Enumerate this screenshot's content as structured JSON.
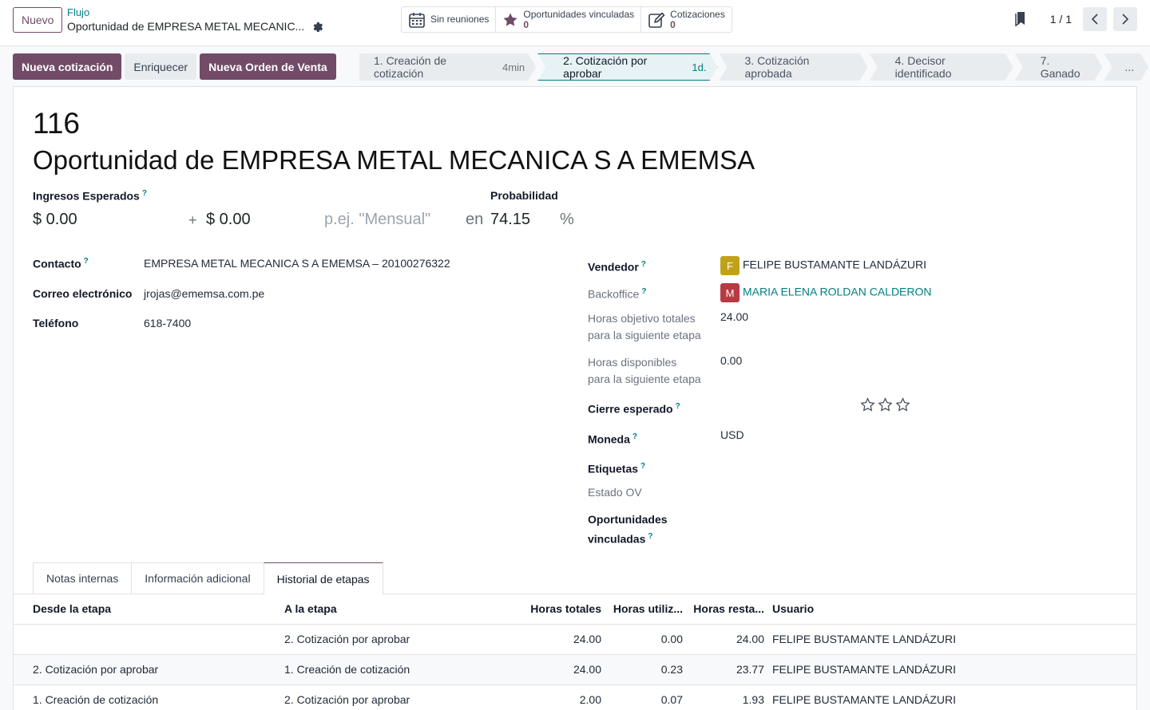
{
  "control_panel": {
    "new_label": "Nuevo",
    "breadcrumb_parent": "Flujo",
    "breadcrumb_current": "Oportunidad de EMPRESA METAL MECANIC...",
    "smart_buttons": [
      {
        "icon": "calendar-icon",
        "label": "Sin reuniones",
        "count": ""
      },
      {
        "icon": "star-icon",
        "label": "Oportunidades vinculadas",
        "count": "0"
      },
      {
        "icon": "edit-icon",
        "label": "Cotizaciones",
        "count": "0"
      }
    ],
    "pager": "1 / 1"
  },
  "actions": {
    "new_quotation": "Nueva cotización",
    "enrich": "Enriquecer",
    "new_sale_order": "Nueva Orden de Venta"
  },
  "stages": [
    {
      "label": "1. Creación de cotización",
      "duration": "4min",
      "active": false
    },
    {
      "label": "2. Cotización por aprobar",
      "duration": "1d.",
      "active": true
    },
    {
      "label": "3. Cotización aprobada",
      "duration": "",
      "active": false
    },
    {
      "label": "4. Decisor identificado",
      "duration": "",
      "active": false
    },
    {
      "label": "7. Ganado",
      "duration": "",
      "active": false
    },
    {
      "label": "...",
      "duration": "",
      "active": false
    }
  ],
  "record": {
    "id": "116",
    "name": "Oportunidad de EMPRESA METAL MECANICA S A EMEMSA",
    "expected_revenue_label": "Ingresos Esperados",
    "expected_revenue": "$ 0.00",
    "plus": "+",
    "recurring_revenue": "$ 0.00",
    "recurring_placeholder": "p.ej. \"Mensual\"",
    "en": "en",
    "probability_label": "Probabilidad",
    "probability": "74.15",
    "percent": "%"
  },
  "left_fields": {
    "contact_label": "Contacto",
    "contact_value": "EMPRESA METAL MECANICA S A EMEMSA – 20100276322",
    "email_label": "Correo electrónico",
    "email_value": "jrojas@ememsa.com.pe",
    "phone_label": "Teléfono",
    "phone_value": "618-7400"
  },
  "right_fields": {
    "salesperson_label": "Vendedor",
    "salesperson_initial": "F",
    "salesperson_value": "FELIPE BUSTAMANTE LANDÁZURI",
    "salesperson_color": "#c0a21a",
    "backoffice_label": "Backoffice",
    "backoffice_initial": "M",
    "backoffice_value": "MARIA ELENA ROLDAN CALDERON",
    "backoffice_color": "#b83a43",
    "target_hours_label_1": "Horas objetivo totales",
    "target_hours_label_2": "para la siguiente etapa",
    "target_hours_value": "24.00",
    "available_hours_label_1": "Horas disponibles",
    "available_hours_label_2": "para la siguiente etapa",
    "available_hours_value": "0.00",
    "expected_close_label": "Cierre esperado",
    "currency_label": "Moneda",
    "currency_value": "USD",
    "tags_label": "Etiquetas",
    "so_status_label": "Estado OV",
    "linked_opps_label_1": "Oportunidades",
    "linked_opps_label_2": "vinculadas",
    "priority_stars": 0,
    "priority_max": 3,
    "help_mark": "?"
  },
  "tabs": [
    {
      "label": "Notas internas",
      "active": false
    },
    {
      "label": "Información adicional",
      "active": false
    },
    {
      "label": "Historial de etapas",
      "active": true
    }
  ],
  "history": {
    "columns": [
      "Desde la etapa",
      "A la etapa",
      "Horas totales",
      "Horas utiliz...",
      "Horas resta...",
      "Usuario"
    ],
    "rows": [
      [
        "",
        "2. Cotización por aprobar",
        "24.00",
        "0.00",
        "24.00",
        "FELIPE BUSTAMANTE LANDÁZURI"
      ],
      [
        "2. Cotización por aprobar",
        "1. Creación de cotización",
        "24.00",
        "0.23",
        "23.77",
        "FELIPE BUSTAMANTE LANDÁZURI"
      ],
      [
        "1. Creación de cotización",
        "2. Cotización por aprobar",
        "2.00",
        "0.07",
        "1.93",
        "FELIPE BUSTAMANTE LANDÁZURI"
      ]
    ]
  },
  "colors": {
    "brand": "#714b67",
    "link": "#017e84"
  }
}
